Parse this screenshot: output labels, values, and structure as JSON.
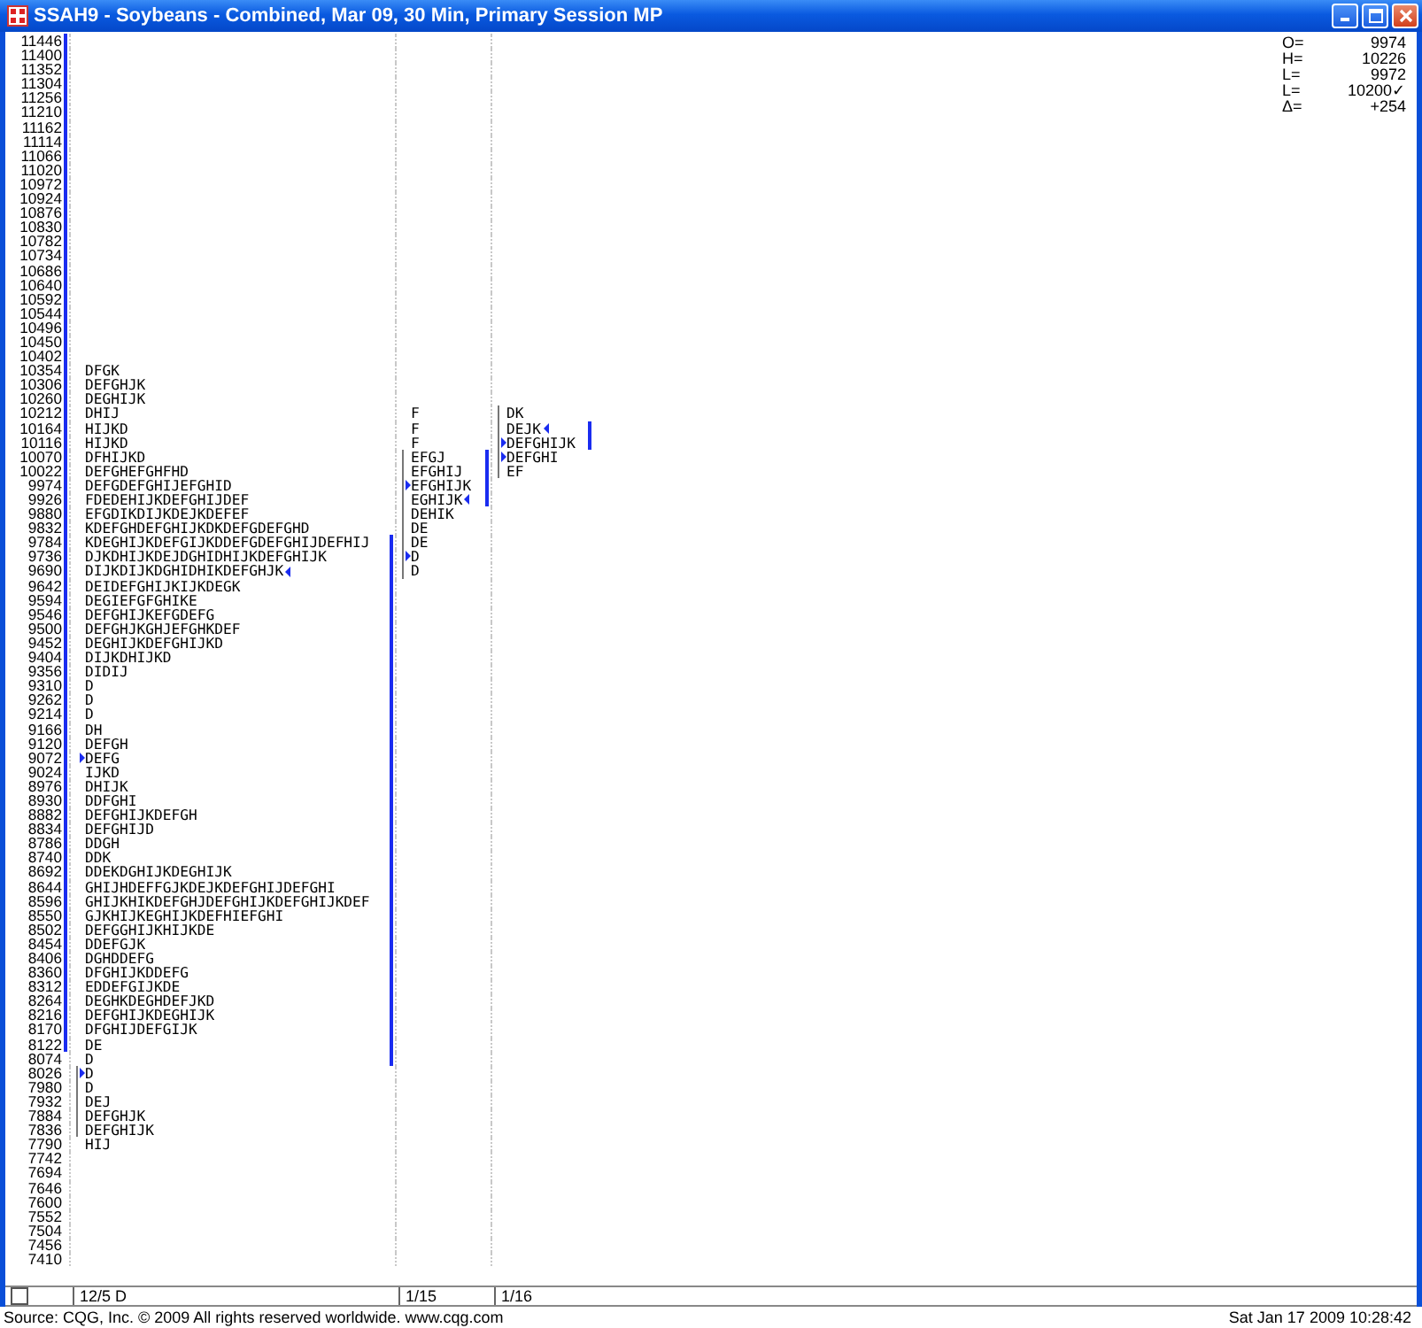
{
  "window": {
    "title": "SSAH9 - Soybeans - Combined, Mar 09, 30 Min, Primary Session MP"
  },
  "stats": [
    {
      "label": "O=",
      "value": "9974"
    },
    {
      "label": "H=",
      "value": "10226"
    },
    {
      "label": "L=",
      "value": "9972"
    },
    {
      "label": "L=",
      "value": "10200✓"
    },
    {
      "label": "Δ=",
      "value": "+254"
    }
  ],
  "rows": [
    {
      "price": "11446",
      "bar": true
    },
    {
      "price": "11400",
      "bar": true
    },
    {
      "price": "11352",
      "bar": true
    },
    {
      "price": "11304",
      "bar": true
    },
    {
      "price": "11256",
      "bar": true
    },
    {
      "price": "11210",
      "bar": true
    },
    {
      "price": "11162",
      "bar": true
    },
    {
      "price": "11114",
      "bar": true
    },
    {
      "price": "11066",
      "bar": true
    },
    {
      "price": "11020",
      "bar": true
    },
    {
      "price": "10972",
      "bar": true
    },
    {
      "price": "10924",
      "bar": true
    },
    {
      "price": "10876",
      "bar": true
    },
    {
      "price": "10830",
      "bar": true
    },
    {
      "price": "10782",
      "bar": true
    },
    {
      "price": "10734",
      "bar": true
    },
    {
      "price": "10686",
      "bar": true
    },
    {
      "price": "10640",
      "bar": true
    },
    {
      "price": "10592",
      "bar": true
    },
    {
      "price": "10544",
      "bar": true
    },
    {
      "price": "10496",
      "bar": true
    },
    {
      "price": "10450",
      "bar": true
    },
    {
      "price": "10402",
      "bar": true
    },
    {
      "price": "10354",
      "bar": true,
      "p1": {
        "text": "DFGK",
        "va": false,
        "ib": false,
        "open": false,
        "close": false
      }
    },
    {
      "price": "10306",
      "bar": true,
      "p1": {
        "text": "DEFGHJK",
        "va": false,
        "ib": false,
        "open": false,
        "close": false
      }
    },
    {
      "price": "10260",
      "bar": true,
      "p1": {
        "text": "DEGHIJK",
        "va": false,
        "ib": false,
        "open": false,
        "close": false
      }
    },
    {
      "price": "10212",
      "bar": true,
      "p1": {
        "text": "DHIJ",
        "va": false,
        "ib": false,
        "open": false,
        "close": false
      },
      "p2": {
        "text": "F",
        "va": false,
        "ib": false,
        "open": false,
        "close": false
      },
      "p3": {
        "text": "DK",
        "va": false,
        "ib": true,
        "open": false,
        "close": false
      }
    },
    {
      "price": "10164",
      "bar": true,
      "p1": {
        "text": "HIJKD",
        "va": false,
        "ib": false,
        "open": false,
        "close": false
      },
      "p2": {
        "text": "F",
        "va": false,
        "ib": false,
        "open": false,
        "close": false
      },
      "p3": {
        "text": "DEJK",
        "va": true,
        "ib": true,
        "open": false,
        "close": true
      }
    },
    {
      "price": "10116",
      "bar": true,
      "p1": {
        "text": "HIJKD",
        "va": false,
        "ib": false,
        "open": false,
        "close": false
      },
      "p2": {
        "text": "F",
        "va": false,
        "ib": false,
        "open": false,
        "close": false
      },
      "p3": {
        "text": "DEFGHIJK",
        "va": true,
        "ib": true,
        "open": true,
        "close": false
      }
    },
    {
      "price": "10070",
      "bar": true,
      "p1": {
        "text": "DFHIJKD",
        "va": false,
        "ib": false,
        "open": false,
        "close": false
      },
      "p2": {
        "text": "EFGJ",
        "va": true,
        "ib": true,
        "open": false,
        "close": false
      },
      "p3": {
        "text": "DEFGHI",
        "va": false,
        "ib": true,
        "open": true,
        "close": false
      }
    },
    {
      "price": "10022",
      "bar": true,
      "p1": {
        "text": "DEFGHEFGHFHD",
        "va": false,
        "ib": false,
        "open": false,
        "close": false
      },
      "p2": {
        "text": "EFGHIJ",
        "va": true,
        "ib": true,
        "open": false,
        "close": false
      },
      "p3": {
        "text": "EF",
        "va": false,
        "ib": true,
        "open": false,
        "close": false
      }
    },
    {
      "price": "9974",
      "bar": true,
      "p1": {
        "text": "DEFGDEFGHIJEFGHID",
        "va": false,
        "ib": false,
        "open": false,
        "close": false
      },
      "p2": {
        "text": "EFGHIJK",
        "va": true,
        "ib": true,
        "open": true,
        "close": false
      }
    },
    {
      "price": "9926",
      "bar": true,
      "p1": {
        "text": "FDEDEHIJKDEFGHIJDEF",
        "va": false,
        "ib": false,
        "open": false,
        "close": false
      },
      "p2": {
        "text": "EGHIJK",
        "va": true,
        "ib": true,
        "open": false,
        "close": true
      }
    },
    {
      "price": "9880",
      "bar": true,
      "p1": {
        "text": "EFGDIKDIJKDEJKDEFEF",
        "va": false,
        "ib": false,
        "open": false,
        "close": false
      },
      "p2": {
        "text": "DEHIK",
        "va": false,
        "ib": true,
        "open": false,
        "close": false
      }
    },
    {
      "price": "9832",
      "bar": true,
      "p1": {
        "text": "KDEFGHDEFGHIJKDKDEFGDEFGHD",
        "va": false,
        "ib": false,
        "open": false,
        "close": false
      },
      "p2": {
        "text": "DE",
        "va": false,
        "ib": true,
        "open": false,
        "close": false
      }
    },
    {
      "price": "9784",
      "bar": true,
      "p1": {
        "text": "KDEGHIJKDEFGIJKDDEFGDEFGHIJDEFHIJ",
        "va": true,
        "ib": false,
        "open": false,
        "close": false
      },
      "p2": {
        "text": "DE",
        "va": false,
        "ib": true,
        "open": false,
        "close": false
      }
    },
    {
      "price": "9736",
      "bar": true,
      "p1": {
        "text": "DJKDHIJKDEJDGHIDHIJKDEFGHIJK",
        "va": true,
        "ib": false,
        "open": false,
        "close": false
      },
      "p2": {
        "text": "D",
        "va": false,
        "ib": true,
        "open": true,
        "close": false
      }
    },
    {
      "price": "9690",
      "bar": true,
      "p1": {
        "text": "DIJKDIJKDGHIDHIKDEFGHJK",
        "va": true,
        "ib": false,
        "open": false,
        "close": true
      },
      "p2": {
        "text": "D",
        "va": false,
        "ib": true,
        "open": false,
        "close": false
      }
    },
    {
      "price": "9642",
      "bar": true,
      "p1": {
        "text": "DEIDEFGHIJKIJKDEGK",
        "va": true,
        "ib": false,
        "open": false,
        "close": false
      }
    },
    {
      "price": "9594",
      "bar": true,
      "p1": {
        "text": "DEGIEFGFGHIKE",
        "va": true,
        "ib": false,
        "open": false,
        "close": false
      }
    },
    {
      "price": "9546",
      "bar": true,
      "p1": {
        "text": "DEFGHIJKEFGDEFG",
        "va": true,
        "ib": false,
        "open": false,
        "close": false
      }
    },
    {
      "price": "9500",
      "bar": true,
      "p1": {
        "text": "DEFGHJKGHJEFGHKDEF",
        "va": true,
        "ib": false,
        "open": false,
        "close": false
      }
    },
    {
      "price": "9452",
      "bar": true,
      "p1": {
        "text": "DEGHIJKDEFGHIJKD",
        "va": true,
        "ib": false,
        "open": false,
        "close": false
      }
    },
    {
      "price": "9404",
      "bar": true,
      "p1": {
        "text": "DIJKDHIJKD",
        "va": true,
        "ib": false,
        "open": false,
        "close": false
      }
    },
    {
      "price": "9356",
      "bar": true,
      "p1": {
        "text": "DIDIJ",
        "va": true,
        "ib": false,
        "open": false,
        "close": false
      }
    },
    {
      "price": "9310",
      "bar": true,
      "p1": {
        "text": "D",
        "va": true,
        "ib": false,
        "open": false,
        "close": false
      }
    },
    {
      "price": "9262",
      "bar": true,
      "p1": {
        "text": "D",
        "va": true,
        "ib": false,
        "open": false,
        "close": false
      }
    },
    {
      "price": "9214",
      "bar": true,
      "p1": {
        "text": "D",
        "va": true,
        "ib": false,
        "open": false,
        "close": false
      }
    },
    {
      "price": "9166",
      "bar": true,
      "p1": {
        "text": "DH",
        "va": true,
        "ib": false,
        "open": false,
        "close": false
      }
    },
    {
      "price": "9120",
      "bar": true,
      "p1": {
        "text": "DEFGH",
        "va": true,
        "ib": false,
        "open": false,
        "close": false
      }
    },
    {
      "price": "9072",
      "bar": true,
      "p1": {
        "text": "DEFG",
        "va": true,
        "ib": false,
        "open": true,
        "close": false
      }
    },
    {
      "price": "9024",
      "bar": true,
      "p1": {
        "text": "IJKD",
        "va": true,
        "ib": false,
        "open": false,
        "close": false
      }
    },
    {
      "price": "8976",
      "bar": true,
      "p1": {
        "text": "DHIJK",
        "va": true,
        "ib": false,
        "open": false,
        "close": false
      }
    },
    {
      "price": "8930",
      "bar": true,
      "p1": {
        "text": "DDFGHI",
        "va": true,
        "ib": false,
        "open": false,
        "close": false
      }
    },
    {
      "price": "8882",
      "bar": true,
      "p1": {
        "text": "DEFGHIJKDEFGH",
        "va": true,
        "ib": false,
        "open": false,
        "close": false
      }
    },
    {
      "price": "8834",
      "bar": true,
      "p1": {
        "text": "DEFGHIJD",
        "va": true,
        "ib": false,
        "open": false,
        "close": false
      }
    },
    {
      "price": "8786",
      "bar": true,
      "p1": {
        "text": "DDGH",
        "va": true,
        "ib": false,
        "open": false,
        "close": false
      }
    },
    {
      "price": "8740",
      "bar": true,
      "p1": {
        "text": "DDK",
        "va": true,
        "ib": false,
        "open": false,
        "close": false
      }
    },
    {
      "price": "8692",
      "bar": true,
      "p1": {
        "text": "DDEKDGHIJKDEGHIJK",
        "va": true,
        "ib": false,
        "open": false,
        "close": false
      }
    },
    {
      "price": "8644",
      "bar": true,
      "p1": {
        "text": "GHIJHDEFFGJKDEJKDEFGHIJDEFGHI",
        "va": true,
        "ib": false,
        "open": false,
        "close": false
      }
    },
    {
      "price": "8596",
      "bar": true,
      "p1": {
        "text": "GHIJKHIKDEFGHJDEFGHIJKDEFGHIJKDEF",
        "va": true,
        "ib": false,
        "open": false,
        "close": false
      }
    },
    {
      "price": "8550",
      "bar": true,
      "p1": {
        "text": "GJKHIJKEGHIJKDEFHIEFGHI",
        "va": true,
        "ib": false,
        "open": false,
        "close": false
      }
    },
    {
      "price": "8502",
      "bar": true,
      "p1": {
        "text": "DEFGGHIJKHIJKDE",
        "va": true,
        "ib": false,
        "open": false,
        "close": false
      }
    },
    {
      "price": "8454",
      "bar": true,
      "p1": {
        "text": "DDEFGJK",
        "va": true,
        "ib": false,
        "open": false,
        "close": false
      }
    },
    {
      "price": "8406",
      "bar": true,
      "p1": {
        "text": "DGHDDEFG",
        "va": true,
        "ib": false,
        "open": false,
        "close": false
      }
    },
    {
      "price": "8360",
      "bar": true,
      "p1": {
        "text": "DFGHIJKDDEFG",
        "va": true,
        "ib": false,
        "open": false,
        "close": false
      }
    },
    {
      "price": "8312",
      "bar": true,
      "p1": {
        "text": "EDDEFGIJKDE",
        "va": true,
        "ib": false,
        "open": false,
        "close": false
      }
    },
    {
      "price": "8264",
      "bar": true,
      "p1": {
        "text": "DEGHKDEGHDEFJKD",
        "va": true,
        "ib": false,
        "open": false,
        "close": false
      }
    },
    {
      "price": "8216",
      "bar": true,
      "p1": {
        "text": "DEFGHIJKDEGHIJK",
        "va": true,
        "ib": false,
        "open": false,
        "close": false
      }
    },
    {
      "price": "8170",
      "bar": true,
      "p1": {
        "text": "DFGHIJDEFGIJK",
        "va": true,
        "ib": false,
        "open": false,
        "close": false
      }
    },
    {
      "price": "8122",
      "bar": true,
      "p1": {
        "text": "DE",
        "va": true,
        "ib": false,
        "open": false,
        "close": false
      }
    },
    {
      "price": "8074",
      "bar": false,
      "p1": {
        "text": "D",
        "va": true,
        "ib": false,
        "open": false,
        "close": false
      }
    },
    {
      "price": "8026",
      "bar": false,
      "p1": {
        "text": "D",
        "va": false,
        "ib": true,
        "open": true,
        "close": false
      }
    },
    {
      "price": "7980",
      "bar": false,
      "p1": {
        "text": "D",
        "va": false,
        "ib": true,
        "open": false,
        "close": false
      }
    },
    {
      "price": "7932",
      "bar": false,
      "p1": {
        "text": "DEJ",
        "va": false,
        "ib": true,
        "open": false,
        "close": false
      }
    },
    {
      "price": "7884",
      "bar": false,
      "p1": {
        "text": "DEFGHJK",
        "va": false,
        "ib": true,
        "open": false,
        "close": false
      }
    },
    {
      "price": "7836",
      "bar": false,
      "p1": {
        "text": "DEFGHIJK",
        "va": false,
        "ib": true,
        "open": false,
        "close": false
      }
    },
    {
      "price": "7790",
      "bar": false,
      "p1": {
        "text": "HIJ",
        "va": false,
        "ib": false,
        "open": false,
        "close": false
      }
    },
    {
      "price": "7742",
      "bar": false
    },
    {
      "price": "7694",
      "bar": false
    },
    {
      "price": "7646",
      "bar": false
    },
    {
      "price": "7600",
      "bar": false
    },
    {
      "price": "7552",
      "bar": false
    },
    {
      "price": "7504",
      "bar": false
    },
    {
      "price": "7456",
      "bar": false
    },
    {
      "price": "7410",
      "bar": false
    }
  ],
  "status_bar": {
    "cells": [
      "12/5 D",
      "1/15",
      "1/16"
    ]
  },
  "footer": {
    "source": "Source: CQG, Inc. © 2009 All rights reserved worldwide. www.cqg.com",
    "timestamp": "Sat Jan 17 2009 10:28:42"
  }
}
